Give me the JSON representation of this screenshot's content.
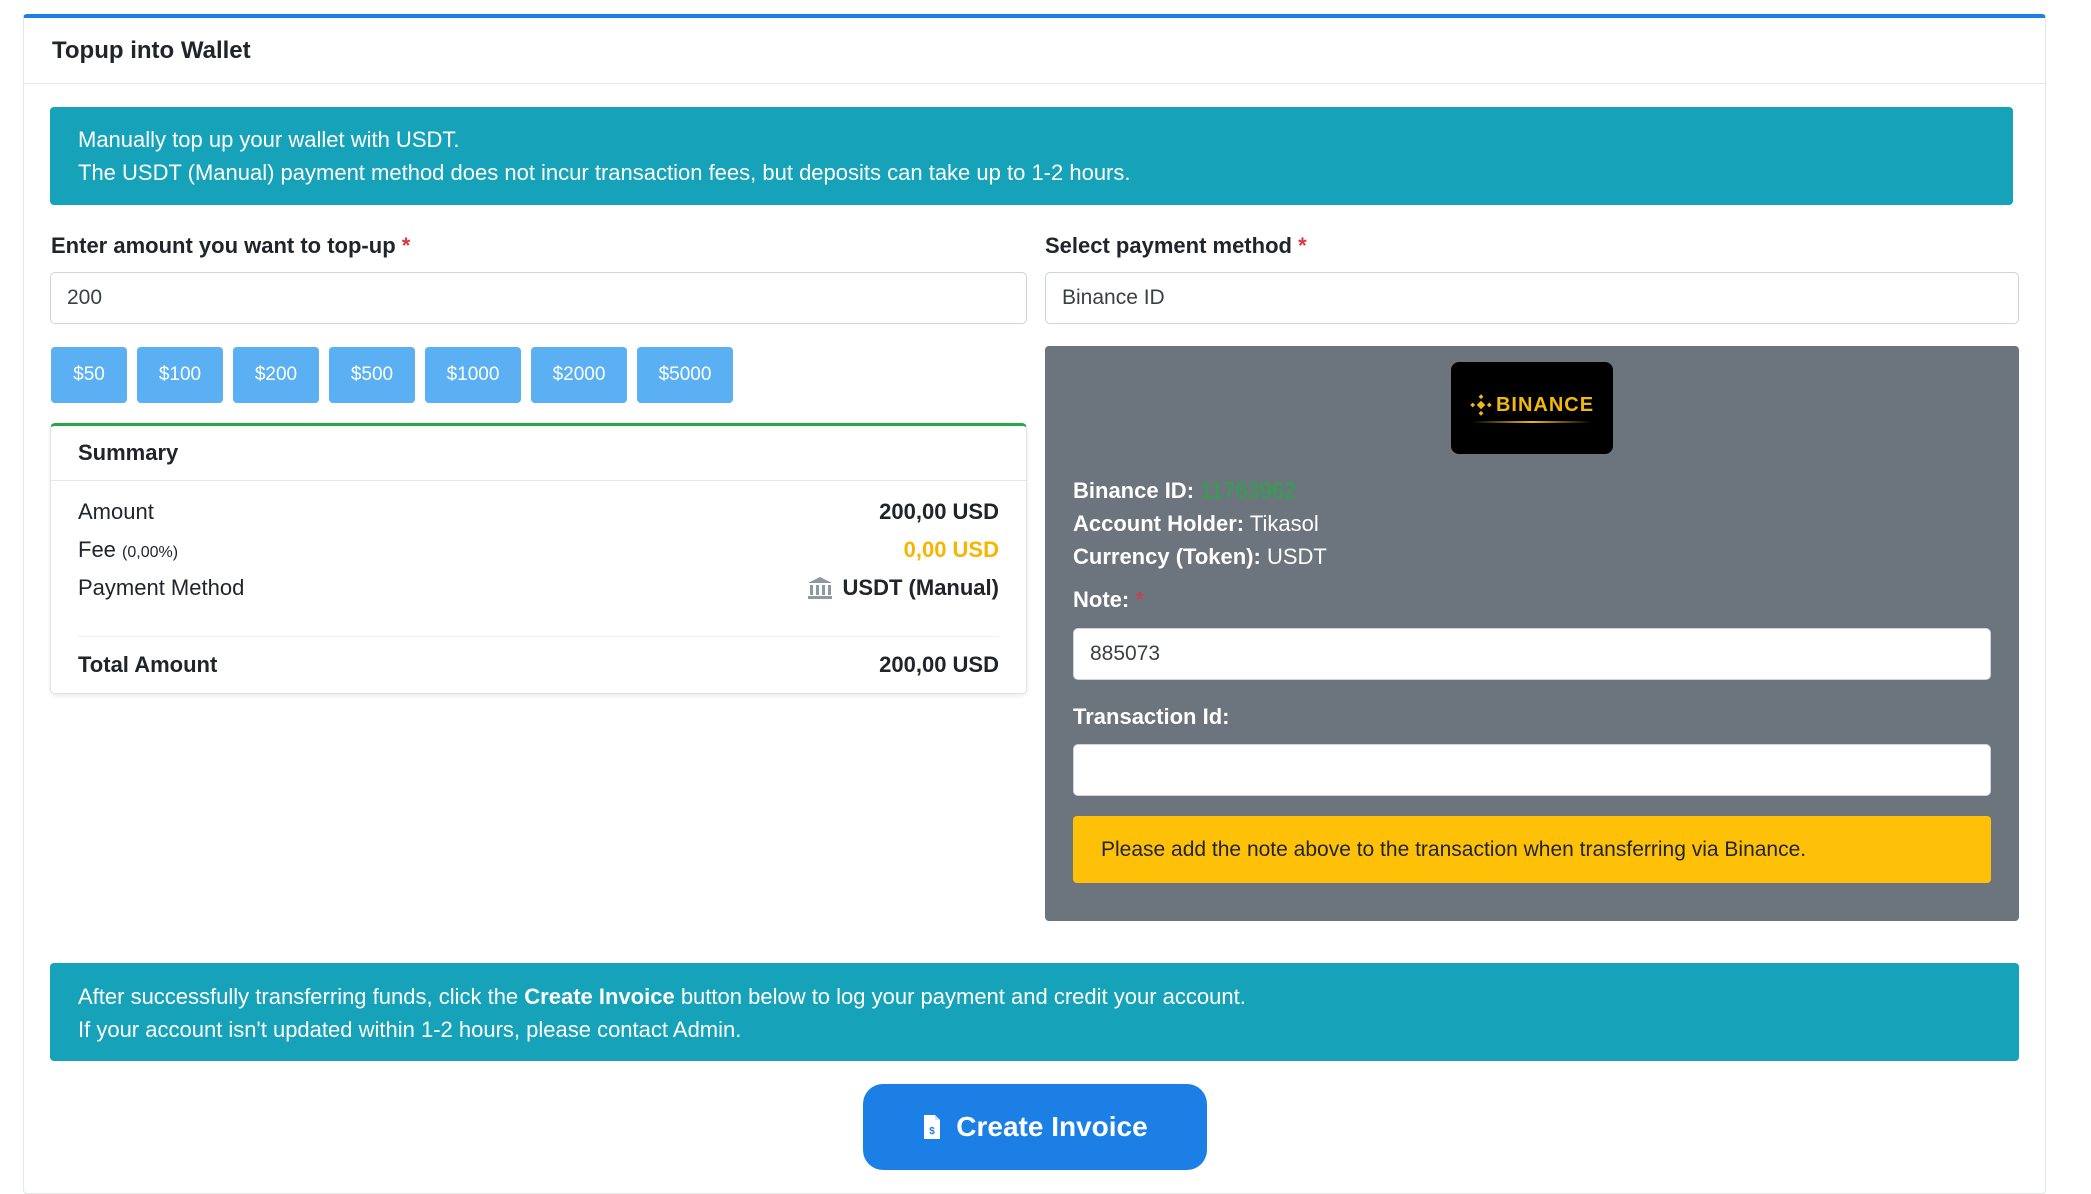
{
  "card": {
    "title": "Topup into Wallet"
  },
  "info_top": {
    "line1": "Manually top up your wallet with USDT.",
    "line2": "The USDT (Manual) payment method does not incur transaction fees, but deposits can take up to 1-2 hours."
  },
  "amount": {
    "label": "Enter amount you want to top-up",
    "required_mark": "*",
    "value": "200",
    "presets": [
      "$50",
      "$100",
      "$200",
      "$500",
      "$1000",
      "$2000",
      "$5000"
    ]
  },
  "summary": {
    "title": "Summary",
    "amount_label": "Amount",
    "amount_value": "200,00 USD",
    "fee_label": "Fee",
    "fee_percent": "(0,00%)",
    "fee_value": "0,00 USD",
    "method_label": "Payment Method",
    "method_value": "USDT (Manual)",
    "total_label": "Total Amount",
    "total_value": "200,00 USD"
  },
  "payment": {
    "label": "Select payment method",
    "required_mark": "*",
    "selected": "Binance ID",
    "logo_text": "BINANCE",
    "binance_id_label": "Binance ID:",
    "binance_id_value": "11763962",
    "holder_label": "Account Holder:",
    "holder_value": "Tikasol",
    "currency_label": "Currency (Token):",
    "currency_value": "USDT",
    "note_label": "Note:",
    "note_required": "*",
    "note_value": "885073",
    "txid_label": "Transaction Id:",
    "txid_value": "",
    "warning": "Please add the note above to the transaction when transferring via Binance."
  },
  "info_bottom": {
    "pre": "After successfully transferring funds, click the ",
    "bold": "Create Invoice",
    "post": " button below to log your payment and credit your account.",
    "line2": "If your account isn't updated within 1-2 hours, please contact Admin."
  },
  "create_button": {
    "label": "Create Invoice",
    "icon": "invoice-icon"
  },
  "colors": {
    "accent": "#1c7fe6",
    "info": "#16a2b8",
    "panel": "#6c757d",
    "warning": "#ffc107",
    "success": "#27a745",
    "fee": "#f7b500",
    "binance": "#f0b90b"
  }
}
